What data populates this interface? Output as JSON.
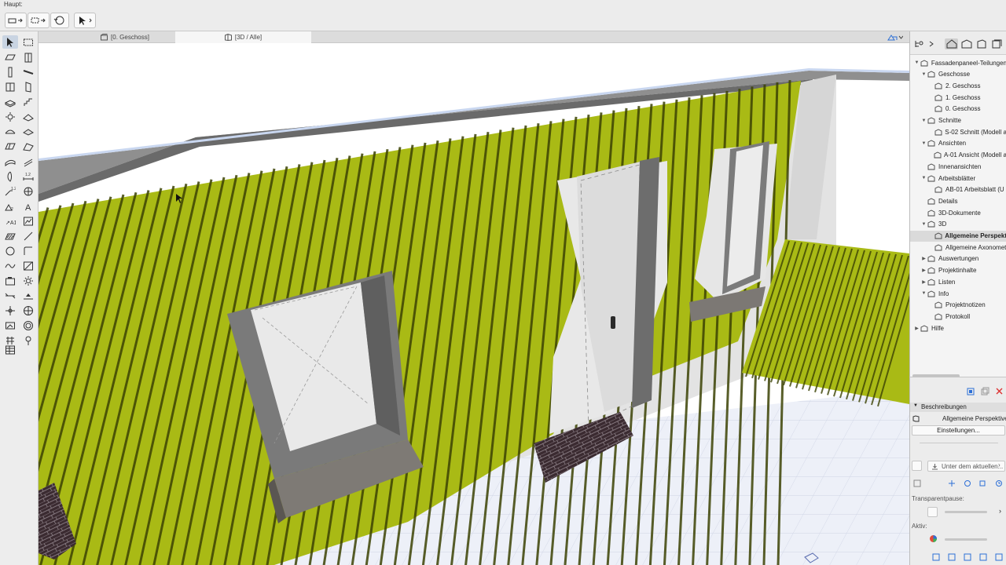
{
  "toolbar": {
    "label": "Haupt:"
  },
  "tabs": [
    {
      "label": "[0. Geschoss]",
      "icon": "floor-plan-icon"
    },
    {
      "label": "[3D / Alle]",
      "icon": "3d-view-icon"
    }
  ],
  "navigator": {
    "tree": [
      {
        "label": "Fassadenpaneel-Teilungen",
        "icon": "project-icon"
      },
      {
        "label": "Geschosse",
        "icon": "stories-icon"
      },
      {
        "label": "2. Geschoss",
        "icon": "story-icon"
      },
      {
        "label": "1. Geschoss",
        "icon": "story-icon"
      },
      {
        "label": "0. Geschoss",
        "icon": "story-icon"
      },
      {
        "label": "Schnitte",
        "icon": "sections-icon"
      },
      {
        "label": "S-02 Schnitt (Modell a",
        "icon": "section-icon"
      },
      {
        "label": "Ansichten",
        "icon": "elevations-icon"
      },
      {
        "label": "A-01 Ansicht (Modell a",
        "icon": "elevation-icon"
      },
      {
        "label": "Innenansichten",
        "icon": "interior-elevations-icon"
      },
      {
        "label": "Arbeitsblätter",
        "icon": "worksheets-icon"
      },
      {
        "label": "AB-01 Arbeitsblatt (U",
        "icon": "worksheet-icon"
      },
      {
        "label": "Details",
        "icon": "details-icon"
      },
      {
        "label": "3D-Dokumente",
        "icon": "3d-documents-icon"
      },
      {
        "label": "3D",
        "icon": "3d-icon"
      },
      {
        "label": "Allgemeine Perspekt",
        "icon": "perspective-icon"
      },
      {
        "label": "Allgemeine Axonomet",
        "icon": "axonometry-icon"
      },
      {
        "label": "Auswertungen",
        "icon": "schedules-icon"
      },
      {
        "label": "Projektinhalte",
        "icon": "project-indexes-icon"
      },
      {
        "label": "Listen",
        "icon": "lists-icon"
      },
      {
        "label": "Info",
        "icon": "info-icon"
      },
      {
        "label": "Projektnotizen",
        "icon": "notes-icon"
      },
      {
        "label": "Protokoll",
        "icon": "report-icon"
      },
      {
        "label": "Hilfe",
        "icon": "help-icon"
      }
    ]
  },
  "inspector": {
    "section_title": "Beschreibungen",
    "view_name": "Allgemeine Perspektive",
    "settings_button": "Einstellungen...",
    "placement_dropdown": "Unter dem aktuellen...",
    "transparency_label": "Transparentpause:",
    "active_label": "Aktiv:"
  },
  "colors": {
    "cladding": "#a6b716",
    "cladding_shadow": "#3c4304",
    "wall": "#e4e4e4",
    "parapet": "#8a8a8a",
    "brick": "#3a2a2f",
    "accent": "#2d6fd6"
  }
}
